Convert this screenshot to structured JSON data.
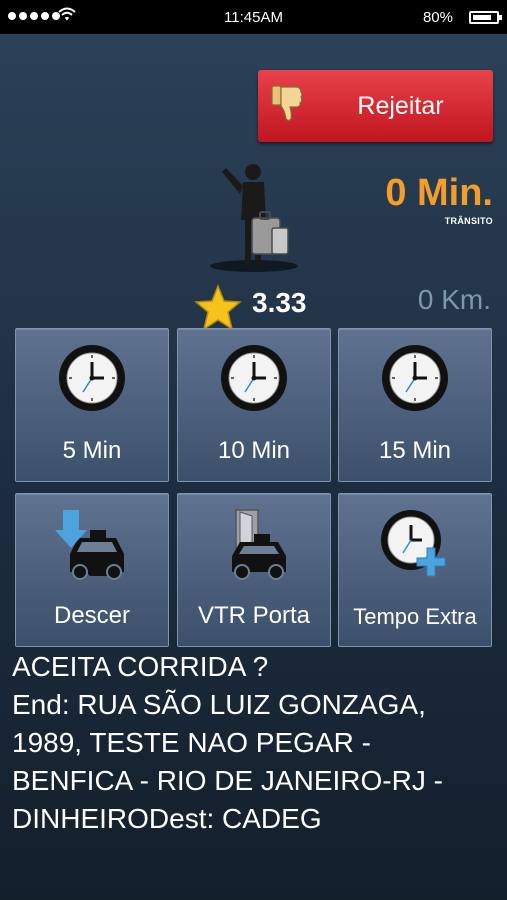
{
  "status_bar": {
    "time": "11:45AM",
    "battery": "80%"
  },
  "reject_button": {
    "label": "Rejeitar"
  },
  "eta": {
    "minutes": "0 Min.",
    "label": "TRÂNSITO"
  },
  "distance": "0 Km.",
  "rating": "3.33",
  "time_options": [
    {
      "label": "5 Min"
    },
    {
      "label": "10 Min"
    },
    {
      "label": "15 Min"
    }
  ],
  "actions": [
    {
      "label": "Descer"
    },
    {
      "label": "VTR Porta"
    },
    {
      "label": "Tempo Extra"
    }
  ],
  "message": {
    "lines": [
      "ACEITA CORRIDA  ?",
      "End: RUA SÃO LUIZ GONZAGA,",
      "1989, TESTE NAO PEGAR -",
      "BENFICA - RIO DE JANEIRO-RJ -",
      "DINHEIRODest: CADEG"
    ]
  },
  "icons": {
    "signal": "signal-dots-icon",
    "wifi": "wifi-icon",
    "battery": "battery-icon",
    "thumbs_down": "thumbs-down-icon",
    "passenger": "passenger-with-luggage-icon",
    "star": "star-icon",
    "clock": "clock-icon",
    "taxi_drop": "taxi-arrow-down-icon",
    "taxi_door": "taxi-door-icon",
    "clock_plus": "clock-plus-icon"
  },
  "colors": {
    "reject": "#d42a33",
    "eta_accent": "#f59d2a",
    "distance_text": "#7d97ad",
    "tile": "#52667f",
    "arrow_blue": "#4da3dd"
  }
}
